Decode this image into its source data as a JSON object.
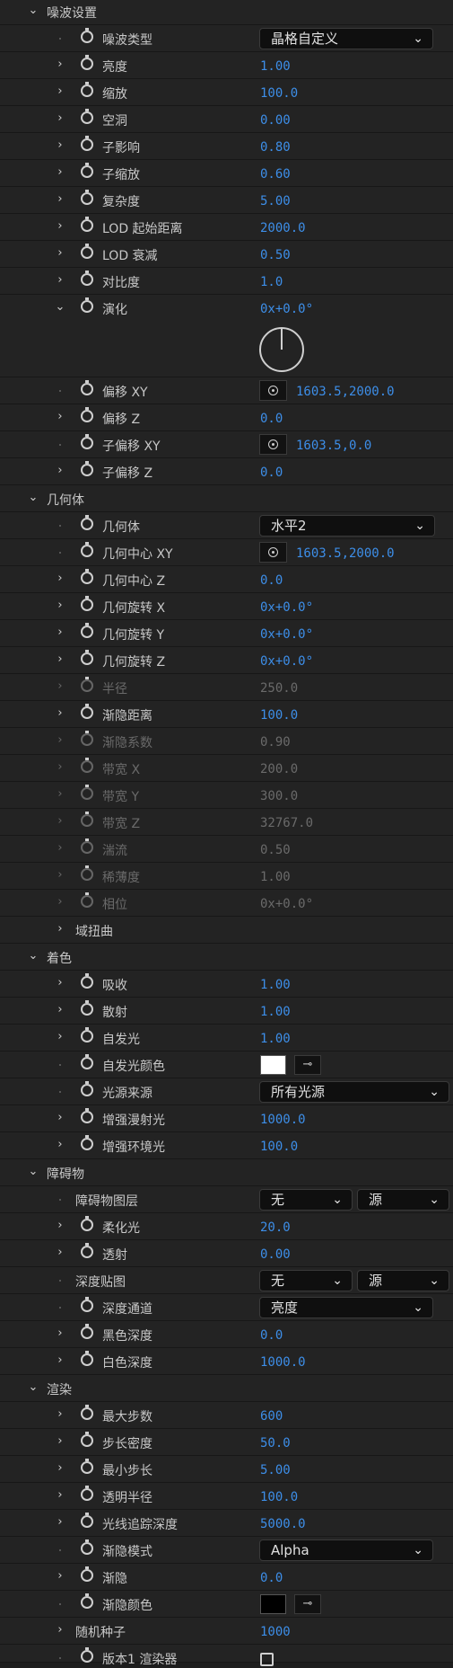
{
  "sections": {
    "noise": "噪波设置",
    "geometry": "几何体",
    "shading": "着色",
    "occlusion": "障碍物",
    "render": "渲染"
  },
  "noise": {
    "type_label": "噪波类型",
    "type_value": "晶格自定义",
    "brightness_label": "亮度",
    "brightness_value": "1.00",
    "scale_label": "缩放",
    "scale_value": "100.0",
    "holes_label": "空洞",
    "holes_value": "0.00",
    "sub_influence_label": "子影响",
    "sub_influence_value": "0.80",
    "sub_scale_label": "子缩放",
    "sub_scale_value": "0.60",
    "complexity_label": "复杂度",
    "complexity_value": "5.00",
    "lod_start_label": "LOD 起始距离",
    "lod_start_value": "2000.0",
    "lod_decay_label": "LOD 衰减",
    "lod_decay_value": "0.50",
    "contrast_label": "对比度",
    "contrast_value": "1.0",
    "evolution_label": "演化",
    "evolution_value": "0x+0.0°",
    "offset_xy_label": "偏移 XY",
    "offset_xy_value": "1603.5,2000.0",
    "offset_z_label": "偏移 Z",
    "offset_z_value": "0.0",
    "sub_offset_xy_label": "子偏移 XY",
    "sub_offset_xy_value": "1603.5,0.0",
    "sub_offset_z_label": "子偏移 Z",
    "sub_offset_z_value": "0.0"
  },
  "geometry": {
    "geom_label": "几何体",
    "geom_value": "水平2",
    "center_xy_label": "几何中心 XY",
    "center_xy_value": "1603.5,2000.0",
    "center_z_label": "几何中心 Z",
    "center_z_value": "0.0",
    "rot_x_label": "几何旋转 X",
    "rot_x_value": "0x+0.0°",
    "rot_y_label": "几何旋转 Y",
    "rot_y_value": "0x+0.0°",
    "rot_z_label": "几何旋转 Z",
    "rot_z_value": "0x+0.0°",
    "radius_label": "半径",
    "radius_value": "250.0",
    "fade_dist_label": "渐隐距离",
    "fade_dist_value": "100.0",
    "fade_coef_label": "渐隐系数",
    "fade_coef_value": "0.90",
    "band_x_label": "带宽 X",
    "band_x_value": "200.0",
    "band_y_label": "带宽 Y",
    "band_y_value": "300.0",
    "band_z_label": "带宽 Z",
    "band_z_value": "32767.0",
    "turbulence_label": "湍流",
    "turbulence_value": "0.50",
    "thinness_label": "稀薄度",
    "thinness_value": "1.00",
    "phase_label": "相位",
    "phase_value": "0x+0.0°",
    "domain_warp_label": "域扭曲"
  },
  "shading": {
    "absorb_label": "吸收",
    "absorb_value": "1.00",
    "scatter_label": "散射",
    "scatter_value": "1.00",
    "emit_label": "自发光",
    "emit_value": "1.00",
    "emit_color_label": "自发光颜色",
    "emit_color": "#ffffff",
    "light_src_label": "光源来源",
    "light_src_value": "所有光源",
    "diffuse_label": "增强漫射光",
    "diffuse_value": "1000.0",
    "ambient_label": "增强环境光",
    "ambient_value": "100.0"
  },
  "occlusion": {
    "layer_label": "障碍物图层",
    "layer_value": "无",
    "layer_source": "源",
    "soften_label": "柔化光",
    "soften_value": "20.0",
    "transmit_label": "透射",
    "transmit_value": "0.00",
    "depth_map_label": "深度贴图",
    "depth_map_value": "无",
    "depth_map_source": "源",
    "depth_channel_label": "深度通道",
    "depth_channel_value": "亮度",
    "black_depth_label": "黑色深度",
    "black_depth_value": "0.0",
    "white_depth_label": "白色深度",
    "white_depth_value": "1000.0"
  },
  "render": {
    "max_steps_label": "最大步数",
    "max_steps_value": "600",
    "step_density_label": "步长密度",
    "step_density_value": "50.0",
    "min_step_label": "最小步长",
    "min_step_value": "5.00",
    "trans_radius_label": "透明半径",
    "trans_radius_value": "100.0",
    "ray_depth_label": "光线追踪深度",
    "ray_depth_value": "5000.0",
    "fade_mode_label": "渐隐模式",
    "fade_mode_value": "Alpha",
    "fade_label": "渐隐",
    "fade_value": "0.0",
    "fade_color_label": "渐隐颜色",
    "fade_color": "#000000",
    "seed_label": "随机种子",
    "seed_value": "1000",
    "v1_renderer_label": "版本1 渲染器"
  },
  "colors": {
    "value_blue": "#3d8ee8",
    "disabled": "#6a6a6a",
    "background": "#1e1e1e"
  },
  "icons": {
    "stopwatch": "stopwatch-icon",
    "expand": "chevron-right-icon",
    "collapse": "chevron-down-icon",
    "target": "crosshair-icon",
    "eyedropper": "eyedropper-icon"
  }
}
